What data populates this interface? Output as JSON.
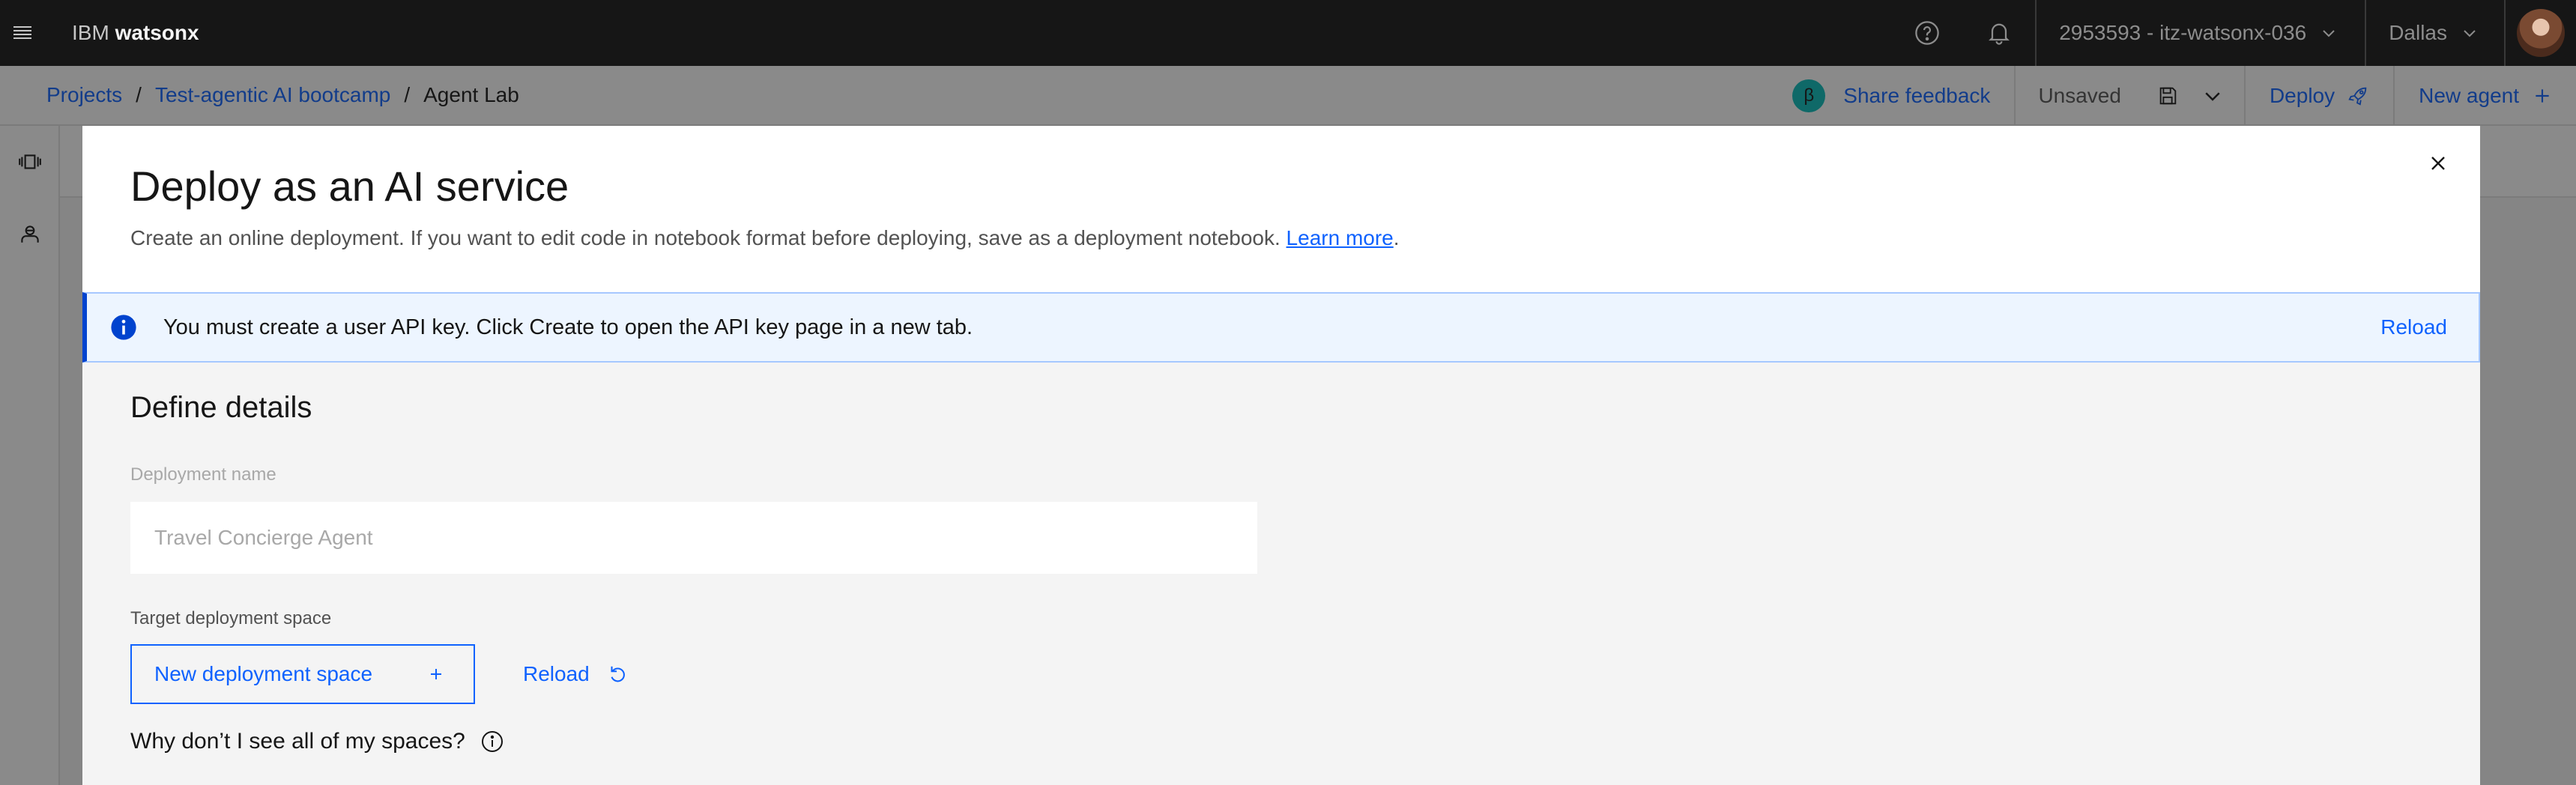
{
  "header": {
    "brand_prefix": "IBM",
    "brand_product": "watsonx",
    "account": "2953593 - itz-watsonx-036",
    "region": "Dallas",
    "icons": [
      "menu-icon",
      "help-icon",
      "notification-icon",
      "chevron-down-icon",
      "avatar"
    ]
  },
  "subbar": {
    "breadcrumbs": [
      "Projects",
      "Test-agentic AI bootcamp",
      "Agent Lab"
    ],
    "separator": "/",
    "beta_badge": "β",
    "share_feedback": "Share feedback",
    "status": "Unsaved",
    "deploy": "Deploy",
    "new_agent": "New agent"
  },
  "modal": {
    "title": "Deploy as an AI service",
    "description": "Create an online deployment. If you want to edit code in notebook format before deploying, save as a deployment notebook.",
    "learn_more": "Learn more",
    "desc_suffix": ".",
    "notification": {
      "message": "You must create a user API key. Click Create to open the API key page in a new tab.",
      "action": "Reload",
      "kind": "info",
      "accent": "#0043ce"
    },
    "section_title": "Define details",
    "deployment_name": {
      "label": "Deployment name",
      "value": "",
      "placeholder": "Travel Concierge Agent"
    },
    "target_space": {
      "label": "Target deployment space",
      "new_button": "New deployment space",
      "reload": "Reload"
    },
    "why_text": "Why don’t I see all of my spaces?"
  },
  "colors": {
    "accent": "#0f62fe",
    "header_bg": "#161616",
    "beta_badge": "#08bdba"
  }
}
